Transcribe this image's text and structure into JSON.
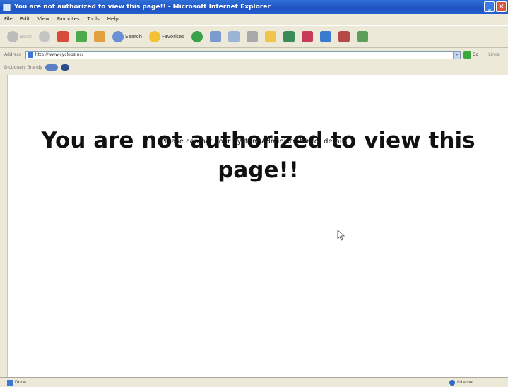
{
  "window": {
    "title": "You are not authorized to view this page!! - Microsoft Internet Explorer",
    "controls": {
      "minimize": "_",
      "maximize": "□",
      "close": "×"
    }
  },
  "menu": [
    "File",
    "Edit",
    "View",
    "Favorites",
    "Tools",
    "Help"
  ],
  "toolbar": {
    "back_label": "Back",
    "search_label": "Search",
    "favorites_label": "Favorites"
  },
  "address": {
    "label": "Address",
    "value": "http://www.cyclops.nc/",
    "go_label": "Go",
    "links_label": "Links"
  },
  "linksbar": {
    "label": "Dictionary Brandy"
  },
  "page": {
    "heading": "You are not authorized to view this page!!",
    "message": "Please contact your System Administrator for details"
  },
  "status": {
    "text": "Done",
    "zone": "Internet"
  },
  "colors": {
    "titlebar": "#1f52c2",
    "chrome": "#ece9d8",
    "content": "#ffffff"
  }
}
